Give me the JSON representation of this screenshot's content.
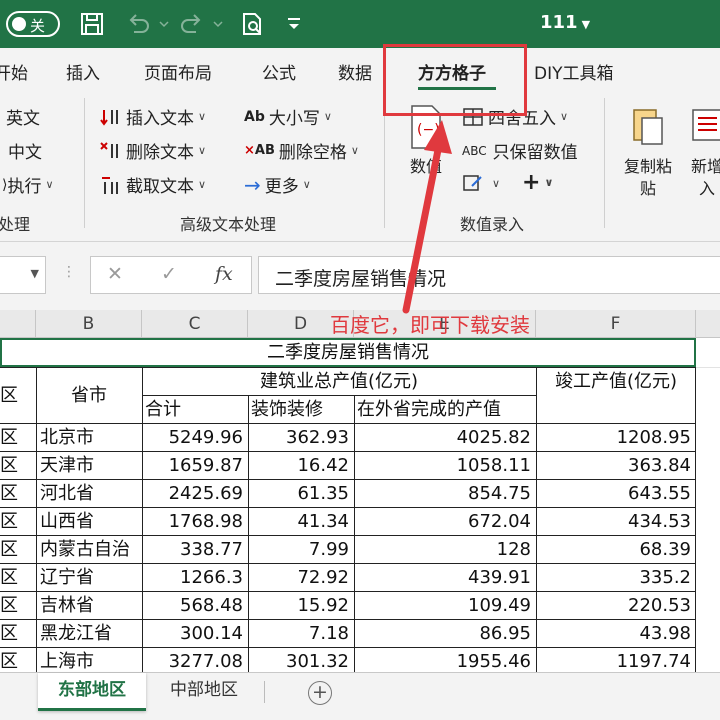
{
  "titlebar": {
    "autosave_label": "关",
    "doc_title": "111",
    "icons": [
      "save-icon",
      "undo-icon",
      "redo-icon",
      "print-preview-icon",
      "customize-qat-icon"
    ],
    "bg_color": "#217346"
  },
  "tabs": [
    {
      "label": "开始"
    },
    {
      "label": "插入"
    },
    {
      "label": "页面布局"
    },
    {
      "label": "公式"
    },
    {
      "label": "数据"
    },
    {
      "label": "方方格子"
    },
    {
      "label": "DIY工具箱"
    }
  ],
  "active_tab": "方方格子",
  "ribbon": {
    "left_group": {
      "items": [
        "英文",
        "中文",
        "执行"
      ],
      "label": "处理"
    },
    "text_group": {
      "items": [
        "插入文本",
        "删除文本",
        "截取文本",
        "大小写",
        "删除空格",
        "更多"
      ],
      "label": "高级文本处理"
    },
    "value_group": {
      "big_button": "数值",
      "items": [
        "四舍五入",
        "只保留数值"
      ],
      "label": "数值录入"
    },
    "right_buttons": [
      {
        "label_line1": "复制粘",
        "label_line2": "贴"
      },
      {
        "label_line1": "新增",
        "label_line2": "入"
      }
    ]
  },
  "formula_bar": {
    "cancel_glyph": "✕",
    "enter_glyph": "✓",
    "fx_label": "fx",
    "content": "二季度房屋销售情况"
  },
  "columns": [
    "B",
    "C",
    "D",
    "E",
    "F"
  ],
  "annotation": "百度它，即可下载安装",
  "table": {
    "title": "二季度房屋销售情况",
    "col_a_header_fragment": "区",
    "header_province": "省市",
    "header_construction_total": "建筑业总产值(亿元)",
    "header_completed": "竣工产值(亿元)",
    "sub_total": "合计",
    "sub_decoration": "装饰装修",
    "sub_outside": "在外省完成的产值",
    "rows": [
      {
        "region": "区",
        "province": "北京市",
        "total": "5249.96",
        "decoration": "362.93",
        "outside": "4025.82",
        "completed": "1208.95"
      },
      {
        "region": "区",
        "province": "天津市",
        "total": "1659.87",
        "decoration": "16.42",
        "outside": "1058.11",
        "completed": "363.84"
      },
      {
        "region": "区",
        "province": "河北省",
        "total": "2425.69",
        "decoration": "61.35",
        "outside": "854.75",
        "completed": "643.55"
      },
      {
        "region": "区",
        "province": "山西省",
        "total": "1768.98",
        "decoration": "41.34",
        "outside": "672.04",
        "completed": "434.53"
      },
      {
        "region": "区",
        "province": "内蒙古自治",
        "total": "338.77",
        "decoration": "7.99",
        "outside": "128",
        "completed": "68.39"
      },
      {
        "region": "区",
        "province": "辽宁省",
        "total": "1266.3",
        "decoration": "72.92",
        "outside": "439.91",
        "completed": "335.2"
      },
      {
        "region": "区",
        "province": "吉林省",
        "total": "568.48",
        "decoration": "15.92",
        "outside": "109.49",
        "completed": "220.53"
      },
      {
        "region": "区",
        "province": "黑龙江省",
        "total": "300.14",
        "decoration": "7.18",
        "outside": "86.95",
        "completed": "43.98"
      },
      {
        "region": "区",
        "province": "上海市",
        "total": "3277.08",
        "decoration": "301.32",
        "outside": "1955.46",
        "completed": "1197.74"
      }
    ]
  },
  "sheet_tabs": [
    {
      "label": "东部地区",
      "active": true
    },
    {
      "label": "中部地区",
      "active": false
    }
  ],
  "add_sheet_glyph": "+"
}
